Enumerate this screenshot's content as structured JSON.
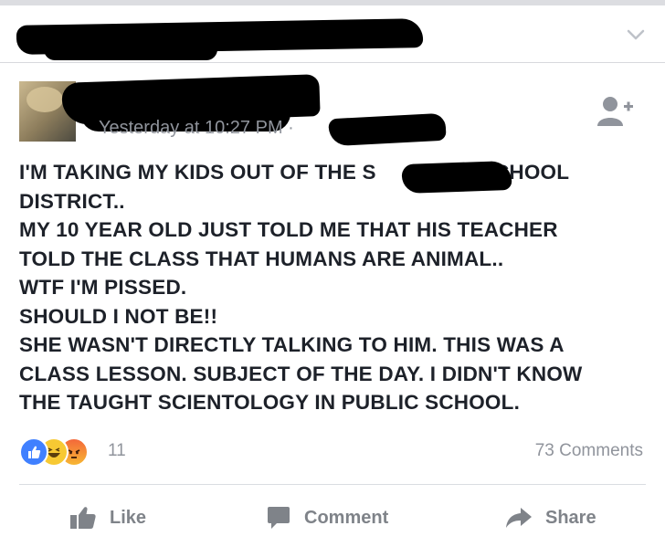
{
  "post": {
    "timestamp": "Yesterday at 10:27 PM ·",
    "lines": [
      "I'M TAKING MY KIDS OUT OF THE S",
      "SCHOOL",
      "DISTRICT..",
      "MY 10 YEAR OLD JUST TOLD ME THAT HIS TEACHER",
      "TOLD THE CLASS THAT HUMANS ARE ANIMAL..",
      "WTF I'M PISSED.",
      "SHOULD I NOT BE!!",
      "SHE WASN'T DIRECTLY TALKING TO HIM. THIS WAS A",
      "CLASS LESSON. SUBJECT OF THE DAY. I DIDN'T KNOW",
      "THE TAUGHT SCIENTOLOGY IN PUBLIC SCHOOL."
    ]
  },
  "reactions": {
    "icons": [
      "like-reaction-icon",
      "haha-reaction-icon",
      "angry-reaction-icon"
    ],
    "count": "11",
    "comments": "73 Comments"
  },
  "actions": {
    "like": "Like",
    "comment": "Comment",
    "share": "Share"
  },
  "colors": {
    "like_blue": "#4080ff",
    "text": "#1d2129",
    "muted": "#90949c"
  }
}
